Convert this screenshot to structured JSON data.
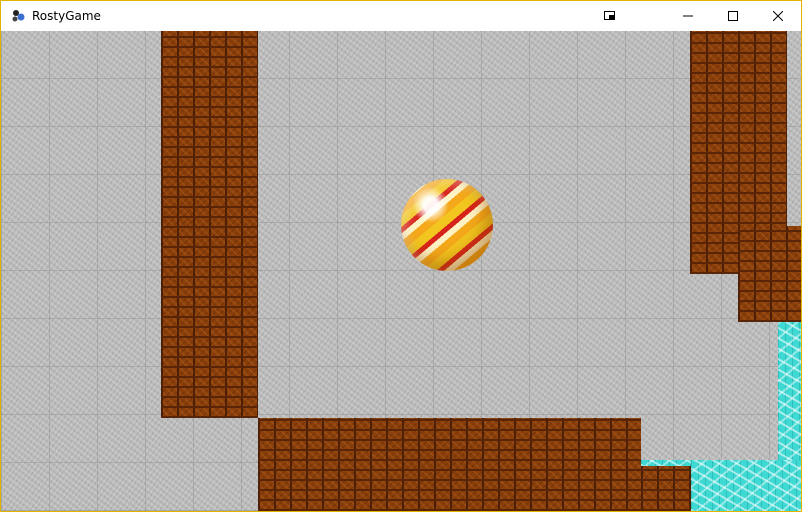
{
  "window": {
    "title": "RostyGame",
    "controls": [
      "restore-tiny-icon",
      "minimize-icon",
      "maximize-icon",
      "close-icon"
    ]
  },
  "game": {
    "tiles": [
      "stone-floor",
      "brick-wall",
      "water"
    ],
    "player": "marble"
  }
}
